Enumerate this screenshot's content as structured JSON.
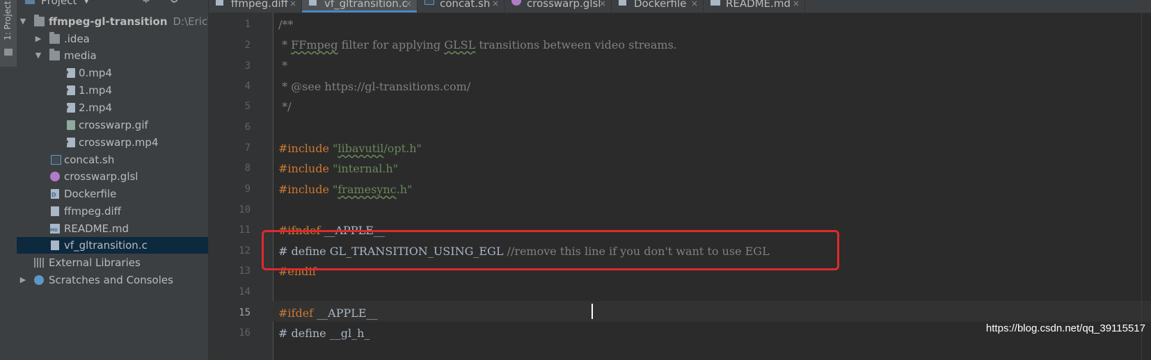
{
  "strip": {
    "tab_label": "1: Project"
  },
  "project_panel": {
    "title": "Project",
    "caret": "▼",
    "toolbar": {
      "collapse_icon": "≑",
      "settings_icon": "⚙",
      "hide_icon": "—"
    },
    "tree": {
      "root": {
        "arrow": "▼",
        "name": "ffmpeg-gl-transition",
        "path": "D:\\Eric\\coc"
      },
      "idea": {
        "arrow": "▶",
        "name": ".idea"
      },
      "media": {
        "arrow": "▼",
        "name": "media"
      },
      "mp4_0": {
        "name": "0.mp4"
      },
      "mp4_1": {
        "name": "1.mp4"
      },
      "mp4_2": {
        "name": "2.mp4"
      },
      "gif": {
        "name": "crosswarp.gif"
      },
      "mp4_cw": {
        "name": "crosswarp.mp4"
      },
      "concat": {
        "name": "concat.sh"
      },
      "glsl": {
        "name": "crosswarp.glsl"
      },
      "docker": {
        "name": "Dockerfile"
      },
      "diff": {
        "name": "ffmpeg.diff"
      },
      "readme": {
        "name": "README.md"
      },
      "vf": {
        "name": "vf_gltransition.c"
      },
      "extlibs": {
        "name": "External Libraries"
      },
      "scratches": {
        "arrow": "▶",
        "name": "Scratches and Consoles"
      }
    }
  },
  "tabs": [
    {
      "label": "ffmpeg.diff",
      "close": "×"
    },
    {
      "label": "vf_gltransition.c",
      "close": "×"
    },
    {
      "label": "concat.sh",
      "close": "×"
    },
    {
      "label": "crosswarp.glsl",
      "close": "×"
    },
    {
      "label": "Dockerfile",
      "close": "×"
    },
    {
      "label": "README.md",
      "close": "×"
    }
  ],
  "line_numbers": [
    "1",
    "2",
    "3",
    "4",
    "5",
    "6",
    "7",
    "8",
    "9",
    "10",
    "11",
    "12",
    "13",
    "14",
    "15",
    "16"
  ],
  "code": {
    "l1": "/**",
    "l2a": " * ",
    "l2b": "FFmpeg",
    "l2c": " filter for applying ",
    "l2d": "GLSL",
    "l2e": " transitions between video streams.",
    "l3": " *",
    "l4": " * @see https://gl-transitions.com/",
    "l5": " */",
    "l7a": "#include ",
    "l7b": "\"",
    "l7c": "libavutil",
    "l7d": "/opt.h\"",
    "l8a": "#include ",
    "l8b": "\"internal.h\"",
    "l9a": "#include ",
    "l9b": "\"",
    "l9c": "framesync",
    "l9d": ".h\"",
    "l11a": "#ifndef",
    "l11b": " __APPLE__",
    "l12a": "# define GL_TRANSITION_USING_EGL ",
    "l12b": "//remove this line if you don't want to use EGL",
    "l13": "#endif",
    "l15a": "#ifdef",
    "l15b": " __APPLE__",
    "l16a": "# define __gl_h_"
  },
  "watermark": "https://blog.csdn.net/qq_39115517"
}
